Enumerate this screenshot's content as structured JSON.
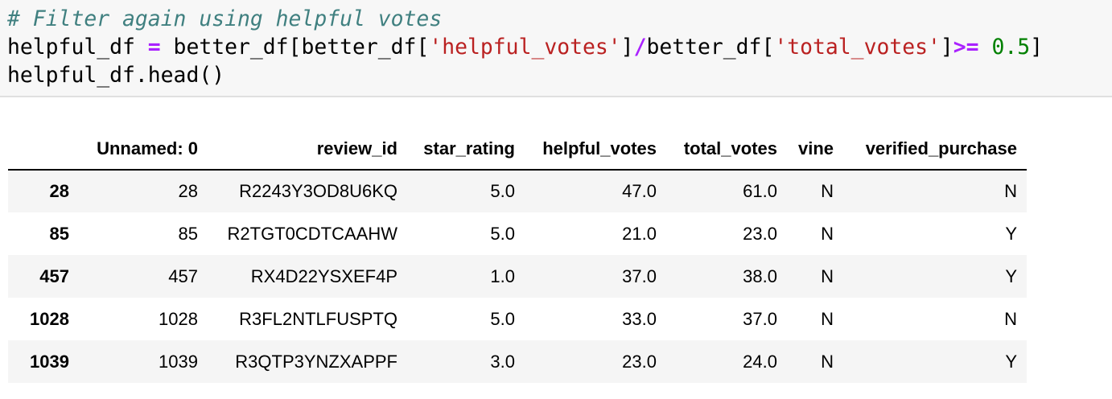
{
  "code_cell": {
    "line1": {
      "comment": "# Filter again using helpful votes"
    },
    "line2": {
      "t1": "helpful_df ",
      "op1": "=",
      "t2": " better_df[better_df[",
      "s1": "'helpful_votes'",
      "t3": "]",
      "op2": "/",
      "t4": "better_df[",
      "s2": "'total_votes'",
      "t5": "]",
      "op3": ">=",
      "t6": " ",
      "n1": "0.5",
      "t7": "]"
    },
    "line3": {
      "t1": "helpful_df.head()"
    }
  },
  "dataframe": {
    "columns": [
      "",
      "Unnamed: 0",
      "review_id",
      "star_rating",
      "helpful_votes",
      "total_votes",
      "vine",
      "verified_purchase"
    ],
    "rows": [
      {
        "index": "28",
        "cells": [
          "28",
          "R2243Y3OD8U6KQ",
          "5.0",
          "47.0",
          "61.0",
          "N",
          "N"
        ]
      },
      {
        "index": "85",
        "cells": [
          "85",
          "R2TGT0CDTCAAHW",
          "5.0",
          "21.0",
          "23.0",
          "N",
          "Y"
        ]
      },
      {
        "index": "457",
        "cells": [
          "457",
          "RX4D22YSXEF4P",
          "1.0",
          "37.0",
          "38.0",
          "N",
          "Y"
        ]
      },
      {
        "index": "1028",
        "cells": [
          "1028",
          "R3FL2NTLFUSPTQ",
          "5.0",
          "33.0",
          "37.0",
          "N",
          "N"
        ]
      },
      {
        "index": "1039",
        "cells": [
          "1039",
          "R3QTP3YNZXAPPF",
          "3.0",
          "23.0",
          "24.0",
          "N",
          "Y"
        ]
      }
    ]
  }
}
